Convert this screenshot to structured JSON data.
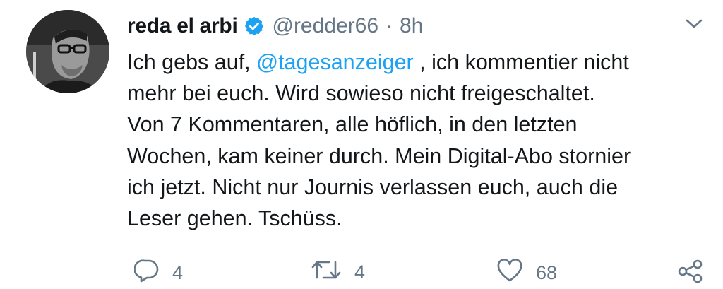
{
  "tweet": {
    "author_name": "reda el arbi",
    "author_handle": "@redder66",
    "separator": "·",
    "timestamp": "8h",
    "verified": true,
    "text_lines": [
      {
        "before": "Ich gebs auf, ",
        "mention": "@tagesanzeiger",
        "after": " , ich kommentier nicht"
      },
      {
        "text": "mehr bei euch. Wird sowieso nicht freigeschaltet."
      },
      {
        "text": "Von 7 Kommentaren, alle höflich, in den letzten"
      },
      {
        "text": "Wochen, kam keiner durch. Mein Digital-Abo stornier"
      },
      {
        "text": "ich jetzt. Nicht nur Journis verlassen euch, auch die"
      },
      {
        "text": "Leser gehen. Tschüss."
      }
    ]
  },
  "actions": {
    "reply_count": "4",
    "retweet_count": "4",
    "like_count": "68"
  },
  "colors": {
    "text": "#14171a",
    "secondary": "#657786",
    "accent": "#1da1f2"
  },
  "icons": {
    "verified": "verified-badge-icon",
    "caret": "chevron-down-icon",
    "reply": "reply-icon",
    "retweet": "retweet-icon",
    "like": "heart-icon",
    "share": "share-icon"
  }
}
